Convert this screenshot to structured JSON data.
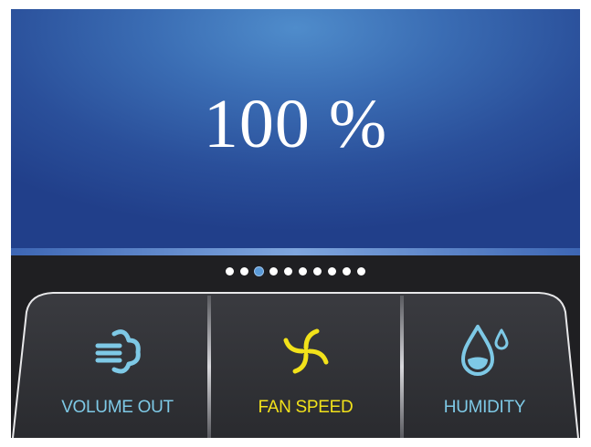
{
  "display": {
    "value": "100 %"
  },
  "pager": {
    "count": 10,
    "active_index": 2
  },
  "modes": [
    {
      "label": "VOLUME OUT",
      "icon": "wind-icon",
      "color": "#7ec9e6",
      "active": false
    },
    {
      "label": "FAN SPEED",
      "icon": "fan-icon",
      "color": "#f2e21a",
      "active": true
    },
    {
      "label": "HUMIDITY",
      "icon": "water-drop-icon",
      "color": "#7ec9e6",
      "active": false
    }
  ],
  "colors": {
    "screen": "#2f5ea6",
    "panel": "#1f1f22",
    "accent_blue": "#7ec9e6",
    "accent_yellow": "#f2e21a"
  }
}
